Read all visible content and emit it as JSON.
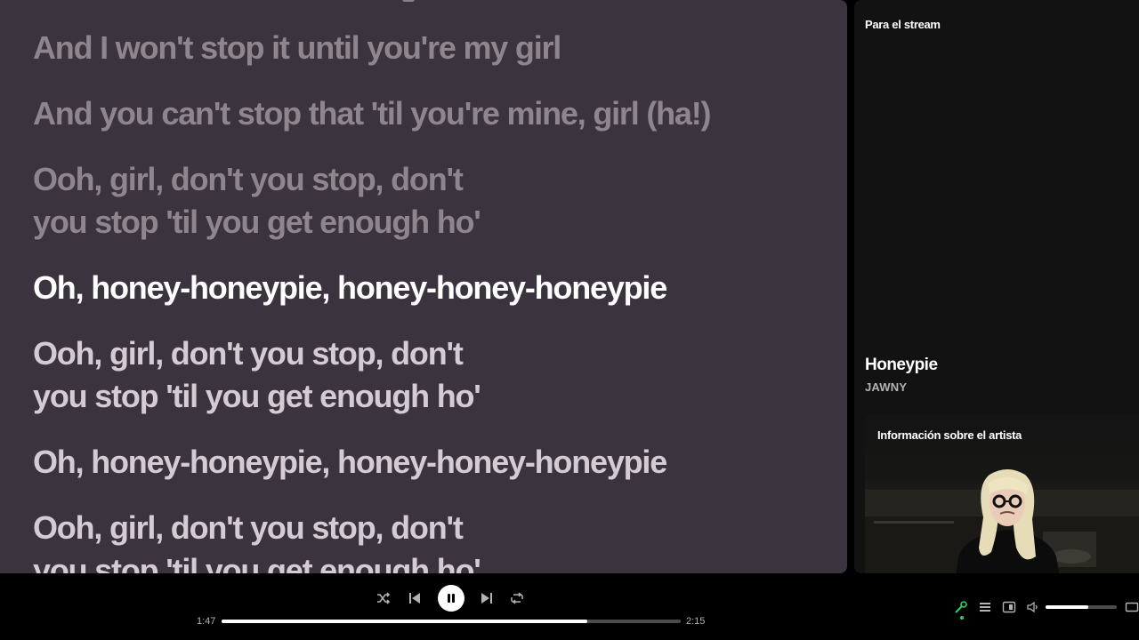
{
  "lyrics": {
    "lines": [
      {
        "text": "And I won't stop it until you're my girl",
        "state": "past"
      },
      {
        "text": "And you can't stop that 'til you're mine, girl (ha!)",
        "state": "past"
      },
      {
        "text": "Ooh, girl, don't you stop, don't\nyou stop 'til you get enough ho'",
        "state": "past"
      },
      {
        "text": "Oh, honey-honeypie, honey-honey-honeypie",
        "state": "active"
      },
      {
        "text": "Ooh, girl, don't you stop, don't\nyou stop 'til you get enough ho'",
        "state": "upcoming"
      },
      {
        "text": "Oh, honey-honeypie, honey-honey-honeypie",
        "state": "upcoming"
      },
      {
        "text": "Ooh, girl, don't you stop, don't\nyou stop 'til you get enough ho'",
        "state": "upcoming"
      }
    ]
  },
  "right_panel": {
    "playlist_name": "Para el stream",
    "song_title": "Honeypie",
    "artist": "JAWNY",
    "artist_card_title": "Información sobre el artista"
  },
  "player": {
    "elapsed": "1:47",
    "duration": "2:15",
    "progress_fraction": 0.797,
    "volume_fraction": 0.6,
    "icons": {
      "shuffle": "shuffle-icon",
      "previous": "previous-icon",
      "pause": "pause-icon",
      "next": "next-icon",
      "repeat": "repeat-icon",
      "lyrics": "microphone-icon",
      "queue": "queue-icon",
      "connect": "connect-device-icon",
      "volume": "volume-icon",
      "miniplayer": "miniplayer-icon"
    }
  },
  "colors": {
    "lyrics_bg": "#3b333d",
    "lyric_past": "#8f858f",
    "lyric_active": "#ffffff",
    "lyric_upcoming": "#d4cbd4",
    "accent_green": "#1ed760"
  }
}
